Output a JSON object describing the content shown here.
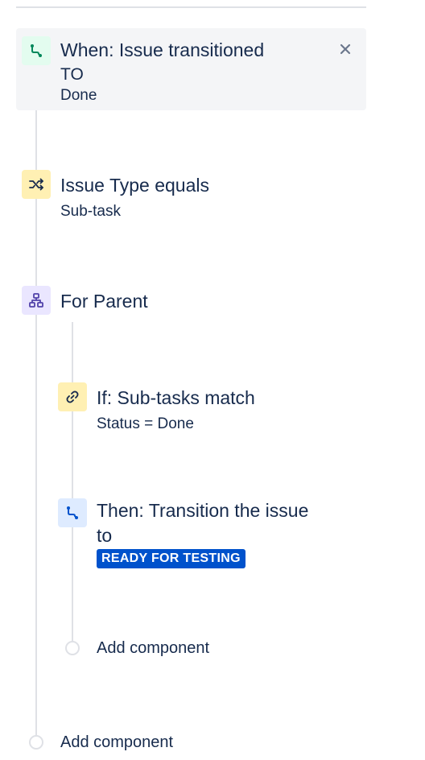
{
  "colors": {
    "trigger_icon": "#00875A",
    "condition_icon": "#172B4D",
    "branch_icon": "#5243AA",
    "action_icon": "#0052CC",
    "lozenge_bg": "#0052CC",
    "lozenge_text": "#FFFFFF",
    "rail": "#DFE1E6"
  },
  "trigger": {
    "icon": "transition-icon",
    "title_line1": "When: Issue transitioned",
    "title_line2": "TO",
    "detail": "Done",
    "close_icon": "close-icon"
  },
  "condition": {
    "icon": "shuffle-icon",
    "title": "Issue Type equals",
    "detail": "Sub-task"
  },
  "branch": {
    "icon": "hierarchy-icon",
    "title": "For Parent",
    "children": {
      "if_block": {
        "icon": "link-icon",
        "title": "If: Sub-tasks match",
        "detail": "Status = Done"
      },
      "then_block": {
        "icon": "transition-icon",
        "title_line1": "Then: Transition the issue",
        "title_line2": "to",
        "status_lozenge": "READY FOR TESTING"
      },
      "add_component_label": "Add component"
    }
  },
  "add_component_label": "Add component"
}
